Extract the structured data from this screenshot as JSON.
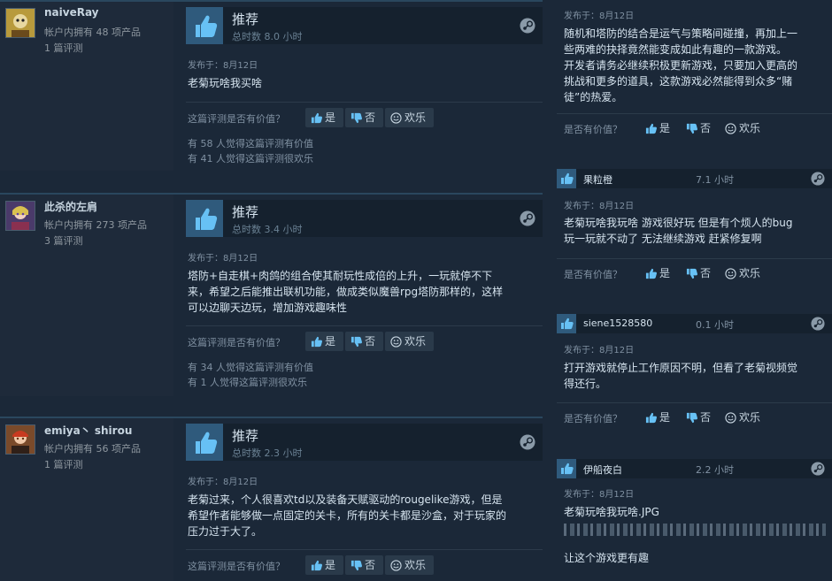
{
  "reviews": [
    {
      "username": "naiveRay",
      "products": "帐户内拥有 48 项产品",
      "review_count": "1 篇评测",
      "verdict": "推荐",
      "hours": "总时数 8.0 小时",
      "posted": "发布于：8月12日",
      "content_lines": [
        "老菊玩啥我买啥"
      ],
      "helpful_q": "这篇评测是否有价值？",
      "yes": "是",
      "no": "否",
      "funny": "欢乐",
      "helpful_stat": "有 58 人觉得这篇评测有价值",
      "funny_stat": "有 41 人觉得这篇评测很欢乐"
    },
    {
      "username": "此杀的左肩",
      "products": "帐户内拥有 273 项产品",
      "review_count": "3 篇评测",
      "verdict": "推荐",
      "hours": "总时数 3.4 小时",
      "posted": "发布于：8月12日",
      "content_lines": [
        "塔防+自走棋+肉鸽的组合使其耐玩性成倍的上升，一玩就停不下",
        "来，希望之后能推出联机功能，做成类似魔兽rpg塔防那样的，这样",
        "可以边聊天边玩，增加游戏趣味性"
      ],
      "helpful_q": "这篇评测是否有价值？",
      "yes": "是",
      "no": "否",
      "funny": "欢乐",
      "helpful_stat": "有 34 人觉得这篇评测有价值",
      "funny_stat": "有 1 人觉得这篇评测很欢乐"
    },
    {
      "username": "emiya丶 shirou",
      "products": "帐户内拥有 56 项产品",
      "review_count": "1 篇评测",
      "verdict": "推荐",
      "hours": "总时数 2.3 小时",
      "posted": "发布于：8月12日",
      "content_lines": [
        "老菊过来，个人很喜欢td以及装备天赋驱动的rougelike游戏，但是",
        "希望作者能够做一点固定的关卡，所有的关卡都是沙盒，对于玩家的",
        "压力过于大了。"
      ],
      "helpful_q": "这篇评测是否有价值？",
      "yes": "是",
      "no": "否",
      "funny": "欢乐"
    }
  ],
  "side_reviews": [
    {
      "posted": "发布于：8月12日",
      "content_lines": [
        "随机和塔防的结合是运气与策略间碰撞，再加上一",
        "些两难的抉择竟然能变成如此有趣的一款游戏。",
        "开发者请务必继续积极更新游戏，只要加入更高的",
        "挑战和更多的道具，这款游戏必然能得到众多“赌",
        "徒”的热爱。"
      ],
      "helpful_q": "是否有价值？",
      "yes": "是",
      "no": "否",
      "funny": "欢乐"
    },
    {
      "name": "果粒橙",
      "hours": "7.1 小时",
      "posted": "发布于：8月12日",
      "content_lines": [
        "老菊玩啥我玩啥 游戏很好玩 但是有个烦人的bug",
        "玩一玩就不动了 无法继续游戏 赶紧修复啊"
      ],
      "helpful_q": "是否有价值？",
      "yes": "是",
      "no": "否",
      "funny": "欢乐"
    },
    {
      "name": "siene1528580",
      "hours": "0.1 小时",
      "posted": "发布于：8月12日",
      "content_lines": [
        "打开游戏就停止工作原因不明，但看了老菊视频觉",
        "得还行。"
      ],
      "helpful_q": "是否有价值？",
      "yes": "是",
      "no": "否",
      "funny": "欢乐"
    },
    {
      "name": "伊船夜白",
      "hours": "2.2 小时",
      "posted": "发布于：8月12日",
      "content_lines": [
        "老菊玩啥我玩啥.JPG"
      ],
      "last_line": "让这个游戏更有趣"
    }
  ]
}
